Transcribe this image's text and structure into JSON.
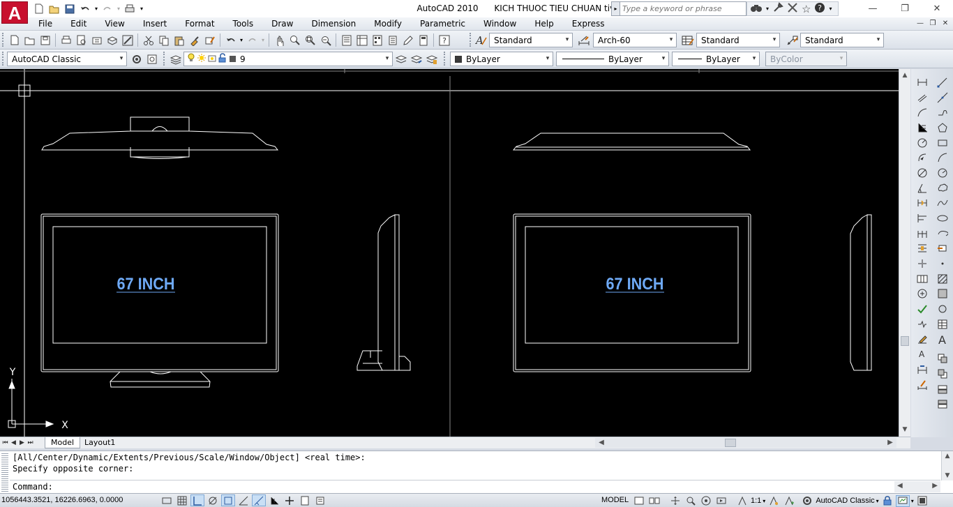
{
  "app": {
    "logo_letter": "A",
    "name": "AutoCAD 2010",
    "document": "KICH THUOC TIEU CHUAN tivi"
  },
  "search": {
    "placeholder": "Type a keyword or phrase"
  },
  "window_controls": {
    "minimize": "—",
    "restore": "❐",
    "close": "✕"
  },
  "menu": [
    "File",
    "Edit",
    "View",
    "Insert",
    "Format",
    "Tools",
    "Draw",
    "Dimension",
    "Modify",
    "Parametric",
    "Window",
    "Help",
    "Express"
  ],
  "styles": {
    "text_style": "Standard",
    "dim_style": "Arch-60",
    "table_style": "Standard",
    "mleader_style": "Standard"
  },
  "workspace": {
    "name": "AutoCAD Classic"
  },
  "layer": {
    "name": "9"
  },
  "properties": {
    "color": "ByLayer",
    "linetype": "ByLayer",
    "lineweight": "ByLayer",
    "plotstyle": "ByColor"
  },
  "drawing": {
    "label_left": "67 INCH",
    "label_right": "67 INCH",
    "axis_x": "X",
    "axis_y": "Y"
  },
  "tabs": {
    "model": "Model",
    "layout": "Layout1"
  },
  "command": {
    "line1": "[All/Center/Dynamic/Extents/Previous/Scale/Window/Object] <real time>:",
    "line2": "Specify opposite corner:",
    "prompt": "Command:"
  },
  "status": {
    "coords": "1056443.3521, 16226.6963, 0.0000",
    "space": "MODEL",
    "annotation_scale": "1:1",
    "workspace": "AutoCAD Classic"
  },
  "colors": {
    "label": "#6ea9f5",
    "background": "#000000",
    "lines": "#ffffff",
    "logo": "#c8102e"
  }
}
